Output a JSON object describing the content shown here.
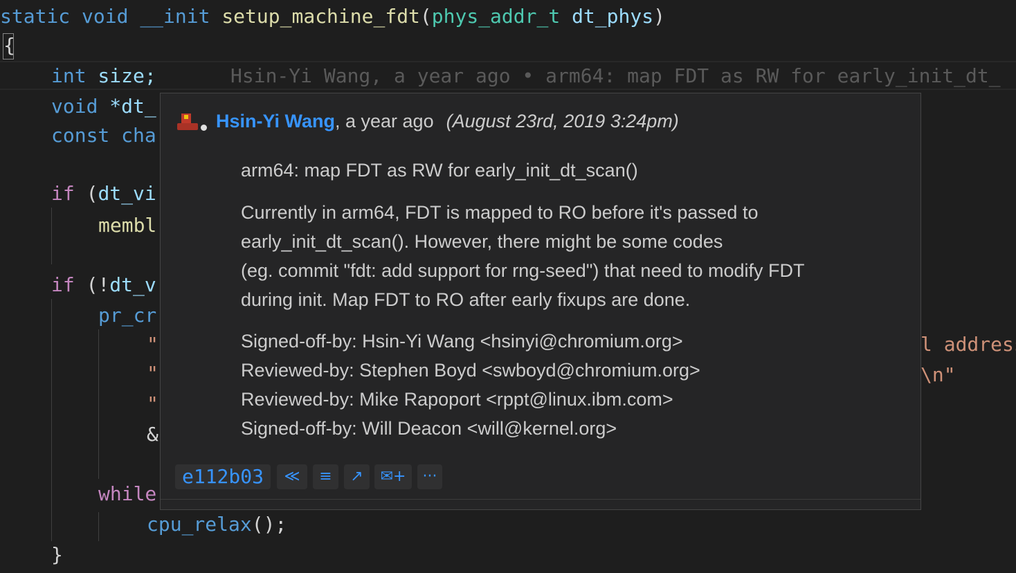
{
  "code": {
    "line1": {
      "kw1": "static",
      "kw2": "void",
      "kw3": "__init",
      "fn": "setup_machine_fdt",
      "paren_open": "(",
      "type": "phys_addr_t",
      "param": "dt_phys",
      "paren_close": ")"
    },
    "line2": "{",
    "line3": {
      "kw": "int",
      "rest": " size;"
    },
    "line4": {
      "kw": "void",
      "rest": " *dt_"
    },
    "line5": {
      "kw": "const",
      "rest": " cha"
    },
    "line6": {
      "kw": "if",
      "rest_plain": " (",
      "var": "dt_vi"
    },
    "line7": "membl",
    "line8": {
      "kw": "if",
      "rest_plain": " (!",
      "var": "dt_v"
    },
    "line9": "pr_cr",
    "line10": "\"",
    "line11": "\"",
    "line12": "\"",
    "line13": "&",
    "line14": "while",
    "line15": {
      "fn": "cpu_relax",
      "rest": "();"
    },
    "line16": "}",
    "right_frag1": "l address",
    "right_frag2": "\\n\""
  },
  "inline_blame": "Hsin-Yi Wang, a year ago • arm64: map FDT as RW for early_init_dt_",
  "hover": {
    "author": "Hsin-Yi Wang",
    "relative_time": ", a year ago",
    "date": "(August 23rd, 2019 3:24pm)",
    "subject": "arm64: map FDT as RW for early_init_dt_scan()",
    "body": [
      "Currently in arm64, FDT is mapped to RO before it's passed to",
      "early_init_dt_scan(). However, there might be some codes",
      "(eg. commit \"fdt: add support for rng-seed\") that need to modify FDT",
      "during init. Map FDT to RO after early fixups are done."
    ],
    "trailers": [
      "Signed-off-by: Hsin-Yi Wang <hsinyi@chromium.org>",
      "Reviewed-by: Stephen Boyd <swboyd@chromium.org>",
      "Reviewed-by: Mike Rapoport <rppt@linux.ibm.com>",
      "Signed-off-by: Will Deacon <will@kernel.org>"
    ],
    "sha": "e112b03",
    "buttons": {
      "previous": "≪",
      "details": "≡",
      "open": "↗",
      "email": "✉+",
      "more": "···"
    },
    "colors": {
      "link": "#3794ff",
      "background": "#252526"
    }
  }
}
